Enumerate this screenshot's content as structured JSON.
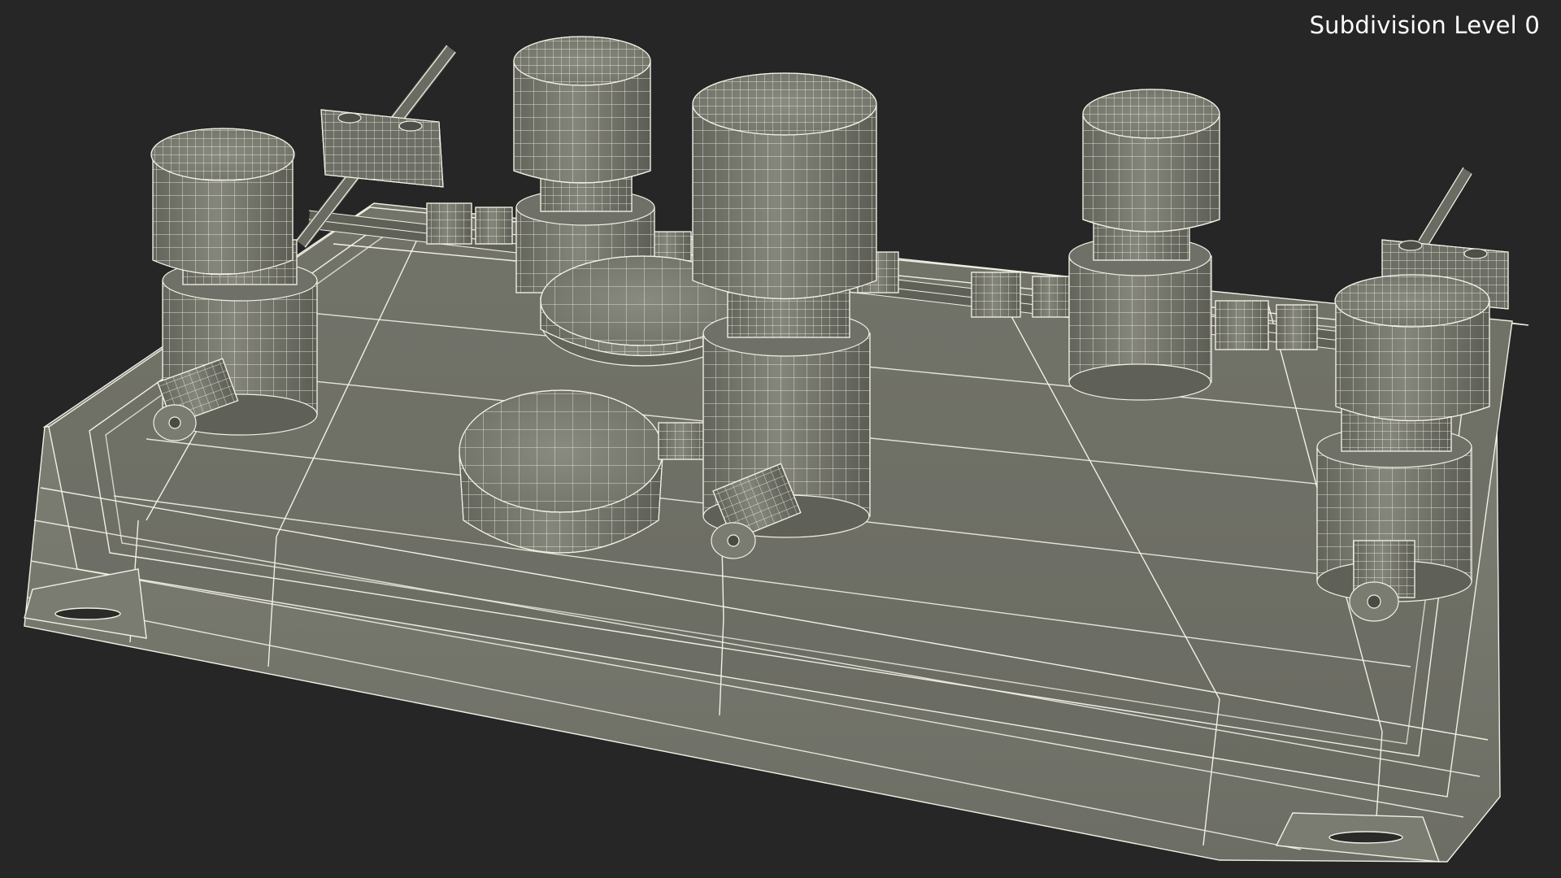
{
  "viewport": {
    "overlay_label": "Subdivision Level 0",
    "background_color": "#262626",
    "model_surface_color": "#6e6f66",
    "wireframe_color": "#f2f0e4"
  }
}
